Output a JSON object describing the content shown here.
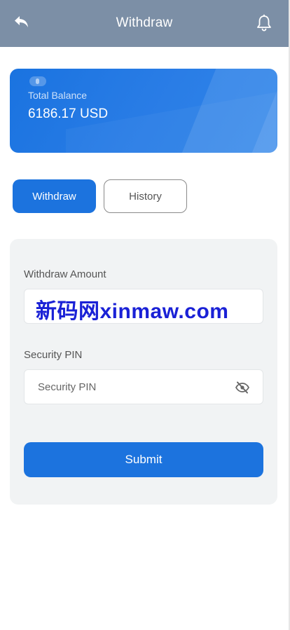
{
  "header": {
    "title": "Withdraw",
    "back_icon": "back-arrow-icon",
    "bell_icon": "bell-icon"
  },
  "balance": {
    "label": "Total Balance",
    "value": "6186.17 USD"
  },
  "tabs": [
    {
      "label": "Withdraw",
      "active": true
    },
    {
      "label": "History",
      "active": false
    }
  ],
  "form": {
    "amount_label": "Withdraw Amount",
    "amount_overlay_text": "新码网xinmaw.com",
    "pin_label": "Security PIN",
    "pin_placeholder": "Security PIN",
    "pin_visibility_icon": "eye-off-icon",
    "submit_label": "Submit"
  },
  "colors": {
    "header_bg": "#7c8fa6",
    "primary": "#1c73de",
    "panel_bg": "#f1f3f4",
    "watermark": "#1a21d6"
  }
}
